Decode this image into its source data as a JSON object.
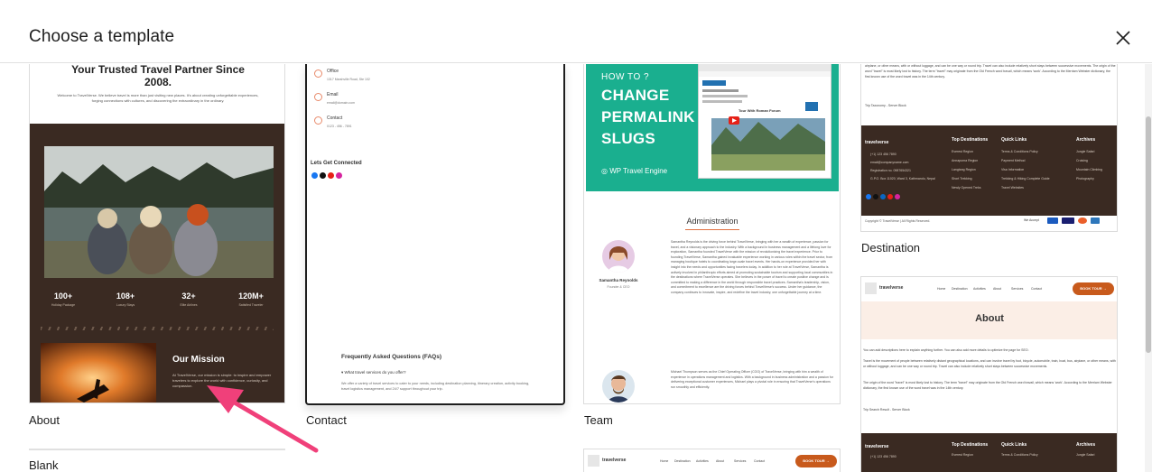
{
  "dialog": {
    "title": "Choose a template",
    "close_label": "Close"
  },
  "templates": [
    {
      "label": "About"
    },
    {
      "label": "Contact"
    },
    {
      "label": "Team"
    },
    {
      "label": "Destination"
    },
    {
      "label": "Blank"
    }
  ],
  "about_preview": {
    "heading": "Your Trusted Travel Partner Since 2008.",
    "intro": "Welcome to TravelVerse. We believe travel is more than just visiting new places. It's about creating unforgettable experiences, forging connections with cultures, and discovering the extraordinary in the ordinary.",
    "stats": [
      {
        "value": "100+",
        "label": "Holiday Package"
      },
      {
        "value": "108+",
        "label": "Luxury Stays"
      },
      {
        "value": "32+",
        "label": "Elite Airlines"
      },
      {
        "value": "120M+",
        "label": "Satisfied Traveler"
      }
    ],
    "mission_title": "Our Mission",
    "mission_text": "At TravelVerse, our mission is simple: to inspire and empower travelers to explore the world with confidence, curiosity, and compassion."
  },
  "contact_preview": {
    "rows": [
      {
        "title": "Office",
        "sub": "1317 Marshville Road, Ste 102"
      },
      {
        "title": "Email",
        "sub": "email@domain.com"
      },
      {
        "title": "Contact",
        "sub": "0123 - 456 - 7891"
      }
    ],
    "connect_heading": "Lets Get Connected",
    "faq_heading": "Frequently Asked Questions (FAQs)",
    "faq_question": "▾ What travel services do you offer?",
    "faq_answer": "We offer a variety of travel services to cater to your needs, including destination planning, itinerary creation, activity booking, travel logistics management, and 24/7 support throughout your trip."
  },
  "team_preview": {
    "hero_small": "HOW TO ?",
    "hero_lines": [
      "CHANGE",
      "PERMALINK",
      "SLUGS"
    ],
    "hero_brand": "WP Travel Engine",
    "shot_caption": "Tour With Roman Forum",
    "section_heading": "Administration",
    "members": [
      {
        "name": "Samantha Reynolds",
        "role": "Founder & CEO",
        "bio": "Samantha Reynolds is the driving force behind TravelVerse, bringing with her a wealth of experience, passion for travel, and a visionary approach to the industry. With a background in business management and a lifelong love for exploration, Samantha founded TravelVerse with the mission of revolutionizing the travel experience. Prior to founding TravelVerse, Samantha gained invaluable experience working in various roles within the travel sector, from managing boutique hotels to coordinating large-scale travel events. Her hands-on experience provided her with insight into the needs and opportunities facing travelers today. In addition to her role at TravelVerse, Samantha is actively involved in philanthropic efforts aimed at promoting sustainable tourism and supporting local communities in the destinations where TravelVerse operates. She believes in the power of travel to create positive change and is committed to making a difference in the world through responsible travel practices. Samantha's leadership, vision, and commitment to excellence are the driving forces behind TravelVerse's success. Under her guidance, the company continues to innovate, inspire, and redefine the travel industry, one unforgettable journey at a time."
      },
      {
        "name": "",
        "role": "",
        "bio": "Michael Thompson serves as the Chief Operating Officer (COO) of TravelVerse, bringing with him a wealth of experience in operations management and logistics. With a background in business administration and a passion for delivering exceptional customer experiences, Michael plays a pivotal role in ensuring that TravelVerse's operations run smoothly and efficiently."
      }
    ]
  },
  "destination_preview": {
    "top_text": "airplane, or other means, with or without luggage, and can be one way or round trip. Travel can also include relatively short stays between successive movements. The origin of the word \"travel\" is most likely lost to history. The term \"travel\" may originate from the Old French word travail, which means 'work'. According to the Merriam Webster dictionary, the first known use of the word travel was in the 14th century.",
    "caption": "Trip Taxonomy - Server Block",
    "footer_brand": "travelverse",
    "contact_lines": [
      "(+1) 123 456 7890",
      "email@companyname.com",
      "Registration no. 0987654321",
      "G.P.O. Box 11020, Ward 3, Kathmandu, Nepal"
    ],
    "columns": [
      {
        "title": "Top Destinations",
        "links": [
          "Everest Region",
          "Annapurna Region",
          "Langtang Region",
          "Short Trekking",
          "Newly Opened Treks"
        ]
      },
      {
        "title": "Quick Links",
        "links": [
          "Terms & Conditions Policy",
          "Payment Method",
          "Visa Information",
          "Trekking & Hiking Complete Guide",
          "Travel Websites"
        ]
      },
      {
        "title": "Archives",
        "links": [
          "Jungle Safari",
          "Cruising",
          "Mountain Climbing",
          "Photography"
        ]
      }
    ],
    "copyright": "Copyright © TravelVerse | All Rights Reserved.",
    "we_accept": "We Accept",
    "payments": [
      {
        "name": "PayPal",
        "color": "#1b5bbf"
      },
      {
        "name": "VISA",
        "color": "#1a1f71"
      },
      {
        "name": "Mastercard",
        "color": "#eb5f2a"
      },
      {
        "name": "Amex",
        "color": "#2e77bb"
      }
    ]
  },
  "about2_preview": {
    "brand": "travelverse",
    "menu": [
      "Home",
      "Destination",
      "Activities",
      "About",
      "Services",
      "Contact"
    ],
    "book_button": "BOOK TOUR →",
    "hero_title": "About",
    "text_1": "You can add descriptions here to explain anything further. You can also add more details to optimize the page for SEO.",
    "text_2": "Travel is the movement of people between relatively distant geographical locations, and can involve travel by foot, bicycle, automobile, train, boat, bus, airplane, or other means, with or without luggage, and can be one way or round trip. Travel can also include relatively short stays between successive movements.",
    "text_3": "The origin of the word \"travel\" is most likely lost to history. The term \"travel\" may originate from the Old French word travail, which means 'work'. According to the Merriam Webster dictionary, the first known use of the word travel was in the 14th century.",
    "caption": "Trip Search Result - Server Block"
  },
  "bottom_nav_preview": {
    "brand": "travelverse",
    "menu": [
      "Home",
      "Destination",
      "Activities",
      "About",
      "Services",
      "Contact"
    ],
    "book_button": "BOOK TOUR →"
  },
  "colors": {
    "accent_arrow": "#f0407a",
    "dark_brown": "#3a2a22",
    "teal": "#1aaf8f",
    "orange": "#c85a1c"
  }
}
